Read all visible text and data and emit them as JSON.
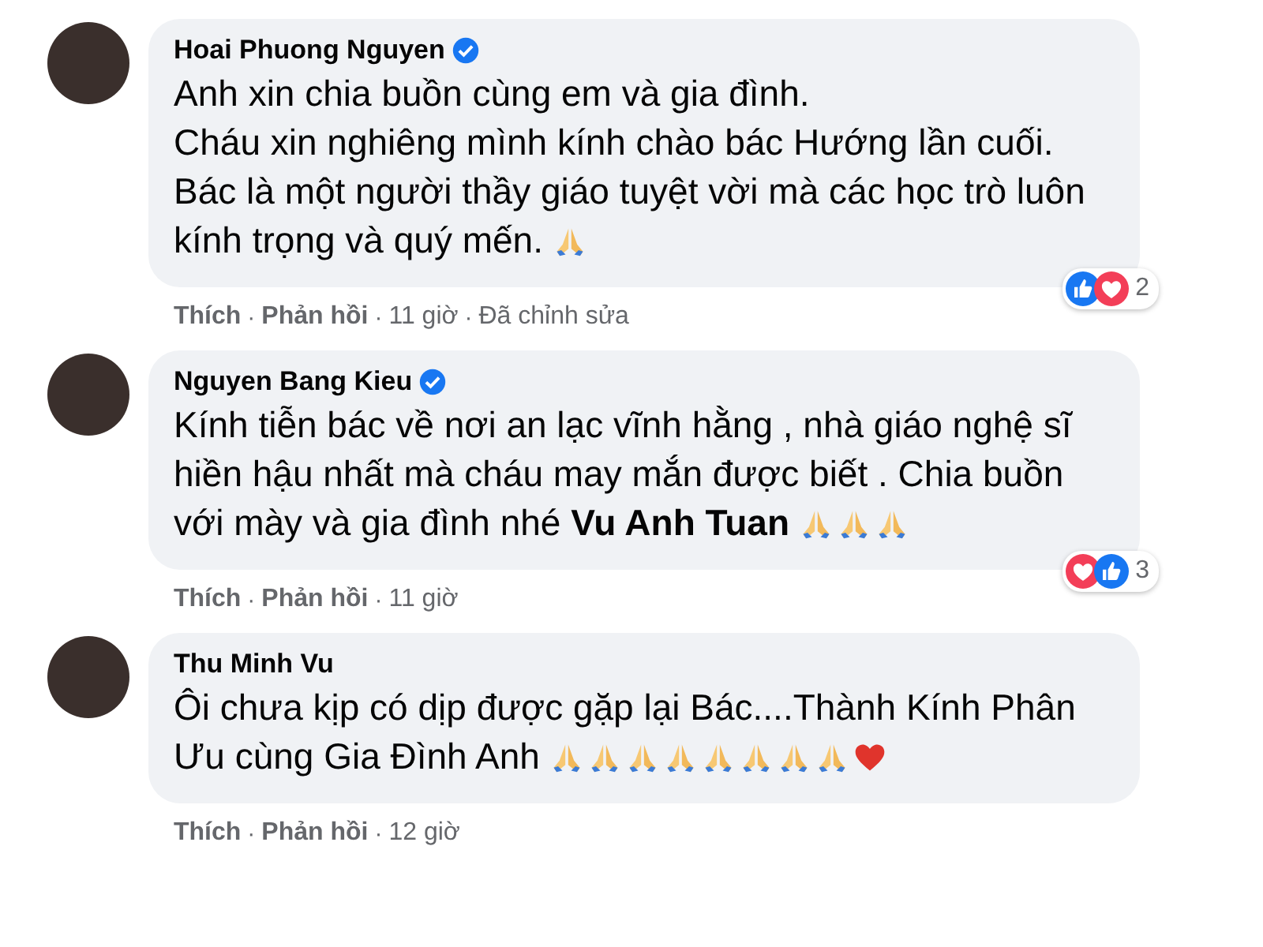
{
  "comments": [
    {
      "author": "Hoai Phuong Nguyen",
      "verified": true,
      "lines": [
        "Anh xin chia buồn cùng em và gia đình.",
        "Cháu xin nghiêng mình kính chào bác Hướng lần cuối.",
        "Bác là một người thầy giáo tuyệt vời mà các học trò luôn",
        "kính trọng và quý mến."
      ],
      "emojis": [
        {
          "kind": "pray"
        }
      ],
      "actions": [
        "Thích",
        "Phản hồi"
      ],
      "separator": "·",
      "time": "11 giờ",
      "edited_label": "Đã chỉnh sửa",
      "reactions": [
        {
          "kind": "like"
        },
        {
          "kind": "love"
        }
      ],
      "reaction_count": "2"
    },
    {
      "author": "Nguyen Bang Kieu",
      "verified": true,
      "lines": [
        "Kính tiễn bác về nơi an lạc vĩnh hằng , nhà giáo nghệ sĩ",
        "hiền hậu nhất mà cháu may mắn được biết . Chia buồn",
        "với mày và gia đình nhé **Vu Anh Tuan**"
      ],
      "emojis": [
        {
          "kind": "pray"
        },
        {
          "kind": "pray"
        },
        {
          "kind": "pray"
        }
      ],
      "actions": [
        "Thích",
        "Phản hồi"
      ],
      "separator": "·",
      "time": "11 giờ",
      "reactions": [
        {
          "kind": "love"
        },
        {
          "kind": "like"
        }
      ],
      "reaction_count": "3"
    },
    {
      "author": "Thu Minh Vu",
      "verified": false,
      "lines": [
        "Ôi chưa kịp có dịp được gặp lại Bác....Thành Kính Phân",
        "Ưu cùng Gia Đình Anh"
      ],
      "emojis": [
        {
          "kind": "pray"
        },
        {
          "kind": "pray"
        },
        {
          "kind": "pray"
        },
        {
          "kind": "pray"
        },
        {
          "kind": "pray"
        },
        {
          "kind": "pray"
        },
        {
          "kind": "pray"
        },
        {
          "kind": "pray"
        },
        {
          "kind": "heart"
        }
      ],
      "actions": [
        "Thích",
        "Phản hồi"
      ],
      "separator": "·",
      "time": "12 giờ"
    }
  ]
}
